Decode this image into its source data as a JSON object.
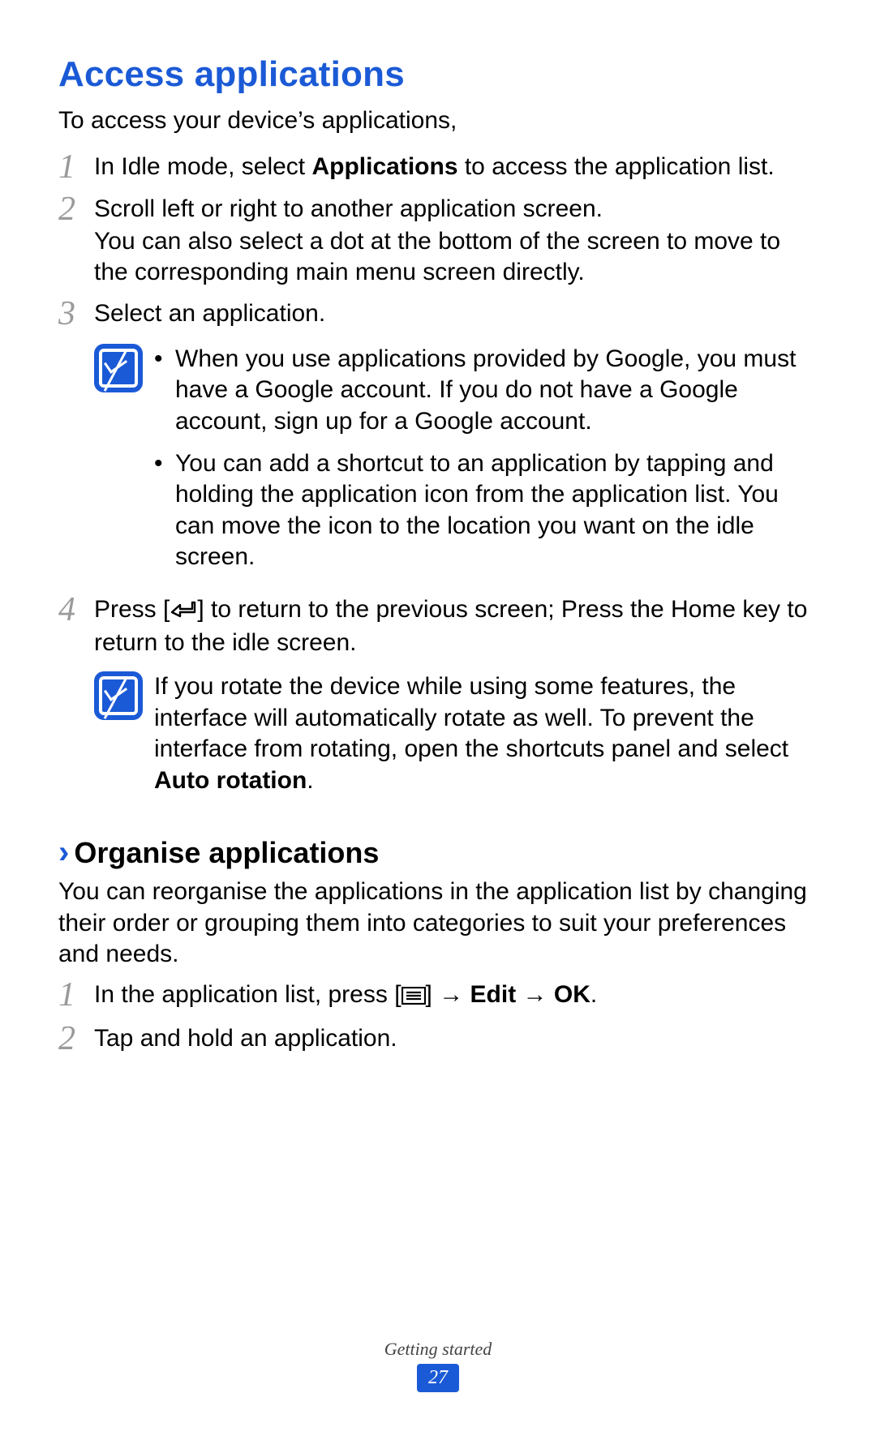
{
  "title": "Access applications",
  "intro": "To access your device’s applications,",
  "steps": {
    "s1": {
      "num": "1",
      "text_pre": "In Idle mode, select ",
      "bold": "Applications",
      "text_post": " to access the application list."
    },
    "s2": {
      "num": "2",
      "line1": "Scroll left or right to another application screen.",
      "line2": "You can also select a dot at the bottom of the screen to move to the corresponding main menu screen directly."
    },
    "s3": {
      "num": "3",
      "text": "Select an application."
    },
    "s4": {
      "num": "4",
      "pre": "Press [",
      "post": "] to return to the previous screen; Press the Home key to return to the idle screen."
    }
  },
  "note1": {
    "b1": "When you use applications provided by Google, you must have a Google account. If you do not have a Google account, sign up for a Google account.",
    "b2": "You can add a shortcut to an application by tapping and holding the application icon from the application list. You can move the icon to the location you want on the idle screen."
  },
  "note2": {
    "pre": "If you rotate the device while using some features, the interface will automatically rotate as well. To prevent the interface from rotating, open the shortcuts panel and select ",
    "bold": "Auto rotation",
    "post": "."
  },
  "sub": {
    "title": "Organise applications",
    "intro": "You can reorganise the applications in the application list by changing their order or grouping them into categories to suit your preferences and needs.",
    "s1": {
      "num": "1",
      "pre": "In the application list, press [",
      "post": "] → ",
      "b1": "Edit",
      "mid": " → ",
      "b2": "OK",
      "end": "."
    },
    "s2": {
      "num": "2",
      "text": "Tap and hold an application."
    }
  },
  "footer": {
    "label": "Getting started",
    "page": "27"
  }
}
